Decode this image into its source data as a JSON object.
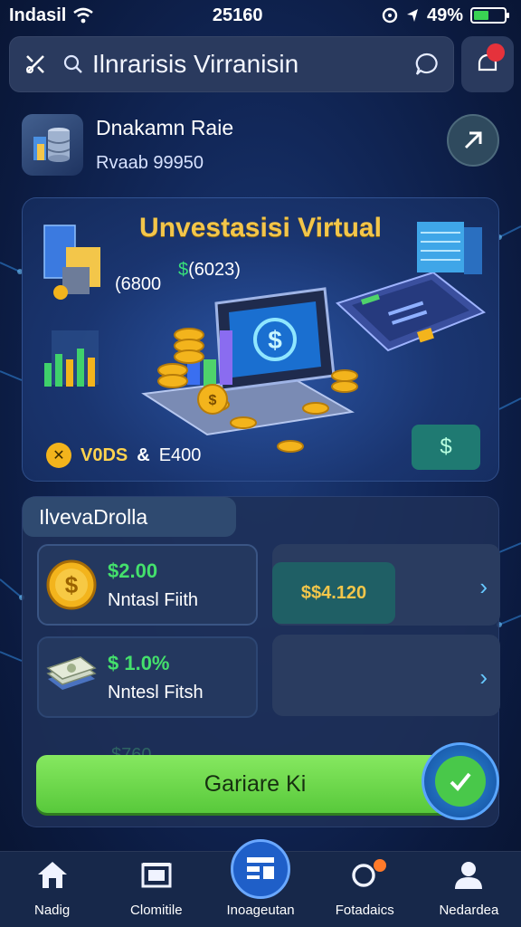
{
  "status_bar": {
    "carrier": "Indasil",
    "time": "25160",
    "battery": "49%",
    "battery_level": 0.49
  },
  "search": {
    "text": "Ilnrarisis Virranisin"
  },
  "profile": {
    "title": "Dnakamn Raie",
    "subtitle": "Rvaab 99950"
  },
  "hero": {
    "title": "Unvestasisi Virtual",
    "value_left": "(6800",
    "value_right_prefix": "$",
    "value_right": "(6023)",
    "stat_label": "V0DS",
    "stat_amp": "&",
    "stat_value": "E400",
    "button_symbol": "$"
  },
  "portfolio": {
    "tab_label": "IlvevaDrolla",
    "assets": [
      {
        "amount": "$2.00",
        "label": "Nntasl Fiith"
      },
      {
        "amount": "$ 1.0%",
        "label": "Nntesl Fitsh"
      }
    ],
    "right_amount": "$$4.120",
    "ghost_amount": "$760",
    "cta_label": "Gariare Ki"
  },
  "nav": [
    {
      "label": "Nadig",
      "icon": "home-icon"
    },
    {
      "label": "Clomitile",
      "icon": "wallet-icon"
    },
    {
      "label": "Inoageutan",
      "icon": "list-icon"
    },
    {
      "label": "Fotadaics",
      "icon": "search-icon"
    },
    {
      "label": "Nedardea",
      "icon": "person-icon"
    }
  ],
  "colors": {
    "accent_green": "#58c93b",
    "gold": "#f3c64a",
    "notification_red": "#e5323b",
    "nav_badge_orange": "#ff7a2a"
  }
}
